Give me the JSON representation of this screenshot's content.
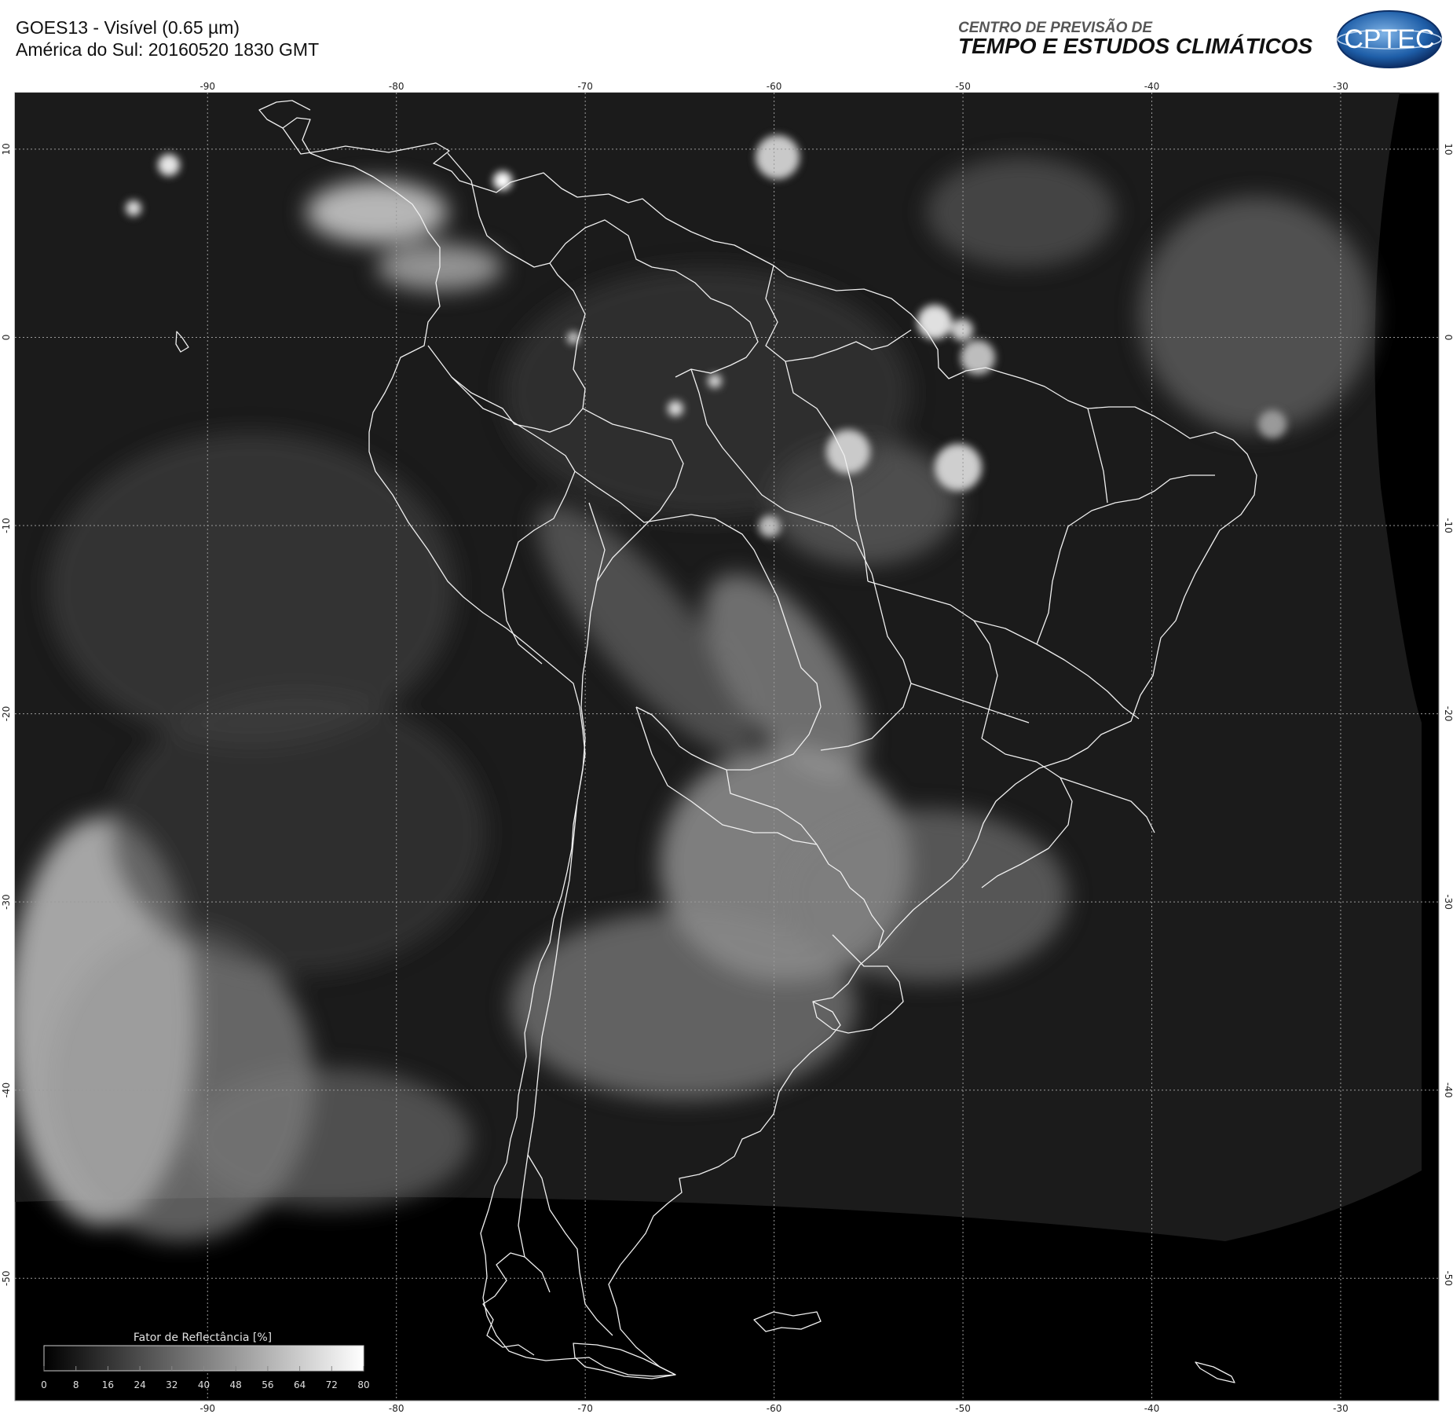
{
  "header": {
    "title_line1": "GOES13 - Visível (0.65 µm)",
    "title_line2": "América do Sul: 20160520 1830 GMT",
    "org_line1": "CENTRO DE PREVISÃO DE",
    "org_line2": "TEMPO E ESTUDOS CLIMÁTICOS",
    "logo_text": "CPTEC"
  },
  "map": {
    "lon_labels": [
      "-90",
      "-80",
      "-70",
      "-60",
      "-50",
      "-40",
      "-30"
    ],
    "lat_labels": [
      "10",
      "0",
      "-10",
      "-20",
      "-30",
      "-40",
      "-50"
    ],
    "lon_range": [
      -100.2,
      -24.8
    ],
    "lat_range": [
      -56.5,
      13
    ],
    "grid": true
  },
  "legend": {
    "title": "Fator de Reflectância [%]",
    "ticks": [
      "0",
      "8",
      "16",
      "24",
      "32",
      "40",
      "48",
      "56",
      "64",
      "72",
      "80"
    ]
  },
  "colors": {
    "background": "#000000",
    "grid": "#9a9a9a",
    "outline": "#f0f0f0",
    "cloud": "#d8d8d8"
  }
}
